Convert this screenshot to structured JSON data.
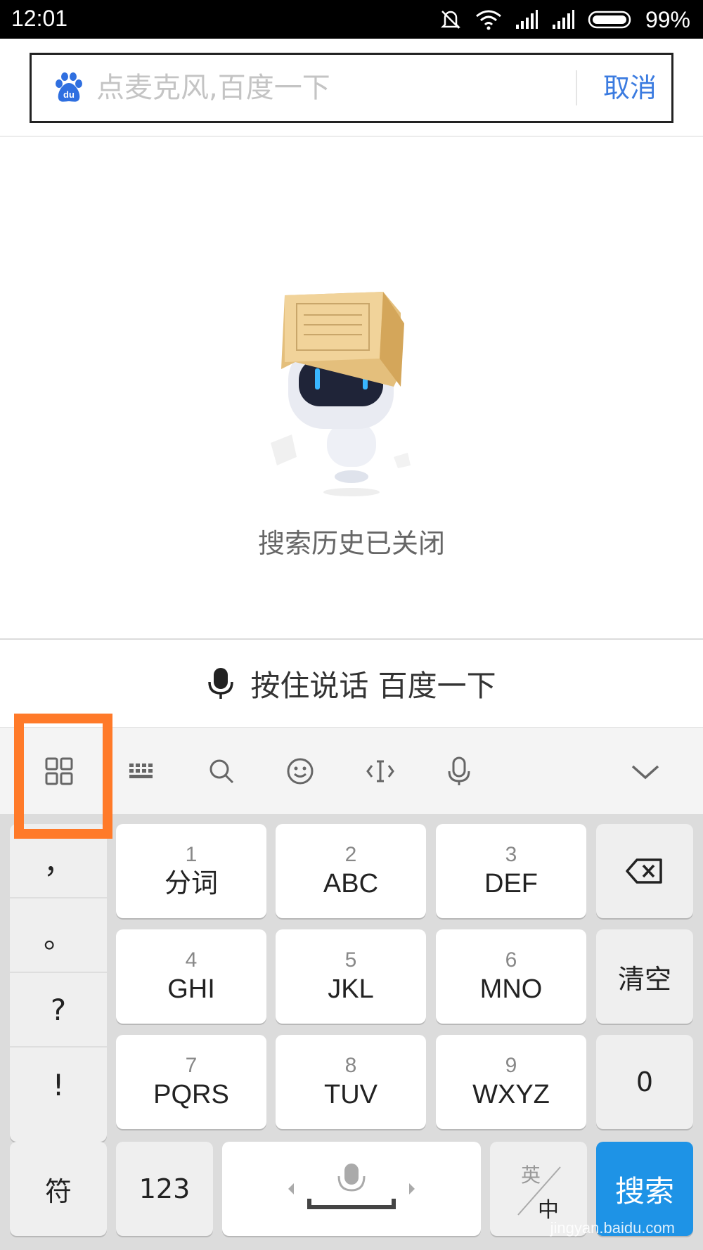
{
  "status_bar": {
    "time": "12:01",
    "battery": "99%"
  },
  "search": {
    "placeholder": "点麦克风,百度一下",
    "cancel_label": "取消",
    "logo_text": "du"
  },
  "empty_state": {
    "message": "搜索历史已关闭"
  },
  "voice_bar": {
    "label": "按住说话 百度一下"
  },
  "toolbar": {
    "icons": [
      "grid-icon",
      "keyboard-icon",
      "search-icon",
      "emoji-icon",
      "cursor-icon",
      "microphone-icon",
      "chevron-down-icon"
    ],
    "highlight_color": "#ff7a29"
  },
  "keyboard": {
    "punctuation": [
      "，",
      "。",
      "?",
      "!"
    ],
    "keys": [
      {
        "num": "1",
        "letters": "分词"
      },
      {
        "num": "2",
        "letters": "ABC"
      },
      {
        "num": "3",
        "letters": "DEF"
      },
      {
        "num": "4",
        "letters": "GHI"
      },
      {
        "num": "5",
        "letters": "JKL"
      },
      {
        "num": "6",
        "letters": "MNO"
      },
      {
        "num": "7",
        "letters": "PQRS"
      },
      {
        "num": "8",
        "letters": "TUV"
      },
      {
        "num": "9",
        "letters": "WXYZ"
      }
    ],
    "clear_label": "清空",
    "zero_label": "0",
    "symbol_label": "符",
    "numeric_label": "123",
    "lang_en": "英",
    "lang_zh": "中",
    "search_label": "搜索",
    "accent_color": "#1e93e6"
  },
  "watermark": "jingyan.baidu.com"
}
